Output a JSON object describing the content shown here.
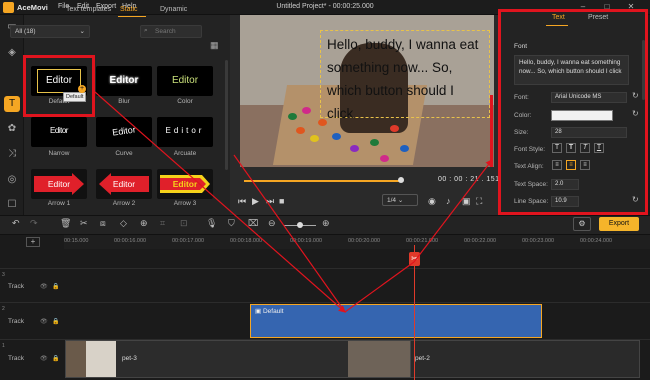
{
  "app": {
    "name": "AceMovi",
    "menu": [
      "File",
      "Edit",
      "Export",
      "Help"
    ],
    "title": "Untitled Project* - 00:00:25.000"
  },
  "library": {
    "tabs": [
      "Text templates",
      "Static",
      "Dynamic"
    ],
    "active_tab": "Static",
    "category": "All (18)",
    "search_placeholder": "Search",
    "preview_text": "Editor",
    "tooltip": "Default",
    "items": [
      {
        "label": "Default"
      },
      {
        "label": "Blur"
      },
      {
        "label": "Color"
      },
      {
        "label": "Narrow"
      },
      {
        "label": "Curve"
      },
      {
        "label": "Arcuate"
      },
      {
        "label": "Arrow 1"
      },
      {
        "label": "Arrow 2"
      },
      {
        "label": "Arrow 3"
      }
    ]
  },
  "preview": {
    "overlay_text": "Hello, buddy, I wanna eat something now... So, which button should I click",
    "timecode": "00 : 00 : 21 . 151",
    "ratio": "1/4",
    "progress_pct": 97
  },
  "properties": {
    "tabs": [
      "Text",
      "Preset"
    ],
    "active_tab": "Text",
    "section": "Font",
    "text_value": "Hello, buddy, I wanna eat something now... So, which button should I click",
    "font_label": "Font:",
    "font_value": "Arial Unicode MS",
    "color_label": "Color:",
    "color_value": "#F2F2F2",
    "size_label": "Size:",
    "size_value": "28",
    "font_style_label": "Font Style:",
    "text_align_label": "Text Align:",
    "text_space_label": "Text Space:",
    "text_space_value": "2.0",
    "line_space_label": "Line Space:",
    "line_space_value": "10.9"
  },
  "toolbar": {
    "export_label": "Export"
  },
  "timeline": {
    "ticks": [
      "00:15.000",
      "00:00:16.000",
      "00:00:17.000",
      "00:00:18.000",
      "00:00:19.000",
      "00:00:20.000",
      "00:00:21.000",
      "00:00:22.000",
      "00:00:23.000",
      "00:00:24.000"
    ],
    "track_label": "Track",
    "text_clip": "Default",
    "clip1": "pet-3",
    "clip2": "pet-2",
    "track_numbers": [
      "1",
      "2",
      "3"
    ]
  },
  "colors": {
    "accent": "#F5A623",
    "highlight": "#E0141E",
    "text_clip": "#3565B0"
  }
}
